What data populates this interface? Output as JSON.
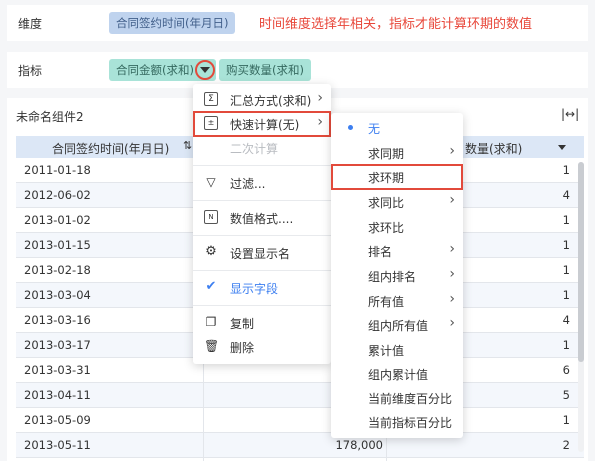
{
  "dimension_bar": {
    "label": "维度",
    "field": "合同签约时间(年月日)",
    "note": "时间维度选择年相关，指标才能计算环期的数值"
  },
  "metric_bar": {
    "label": "指标",
    "field1": "合同金额(求和)",
    "field2": "购买数量(求和)"
  },
  "component": {
    "title": "未命名组件2",
    "col1": "合同签约时间(年月日)",
    "col3": "数量(求和)"
  },
  "rows": [
    {
      "date": "2011-01-18",
      "mid": "",
      "right": "1"
    },
    {
      "date": "2012-06-02",
      "mid": "",
      "right": "4"
    },
    {
      "date": "2013-01-02",
      "mid": "",
      "right": "1"
    },
    {
      "date": "2013-01-15",
      "mid": "",
      "right": "1"
    },
    {
      "date": "2013-02-18",
      "mid": "",
      "right": "1"
    },
    {
      "date": "2013-03-04",
      "mid": "",
      "right": "1"
    },
    {
      "date": "2013-03-16",
      "mid": "",
      "right": "4"
    },
    {
      "date": "2013-03-17",
      "mid": "",
      "right": "1"
    },
    {
      "date": "2013-03-31",
      "mid": "",
      "right": "6"
    },
    {
      "date": "2013-04-11",
      "mid": "",
      "right": "5"
    },
    {
      "date": "2013-05-09",
      "mid": "",
      "right": "1"
    },
    {
      "date": "2013-05-11",
      "mid": "178,000",
      "right": "2"
    }
  ],
  "context_menu": {
    "items": [
      {
        "label": "汇总方式(求和)",
        "icon": "sum-icon"
      },
      {
        "label": "快速计算(无)",
        "icon": "calc-icon"
      },
      {
        "label": "二次计算",
        "icon": ""
      },
      {
        "label": "过滤...",
        "icon": "filter-icon"
      },
      {
        "label": "数值格式....",
        "icon": "number-format-icon"
      },
      {
        "label": "设置显示名",
        "icon": "gear-icon"
      },
      {
        "label": "显示字段",
        "icon": "check-icon"
      },
      {
        "label": "复制",
        "icon": "copy-icon"
      },
      {
        "label": "删除",
        "icon": "trash-icon"
      }
    ]
  },
  "submenu": {
    "items": [
      {
        "label": "无"
      },
      {
        "label": "求同期"
      },
      {
        "label": "求环期"
      },
      {
        "label": "求同比"
      },
      {
        "label": "求环比"
      },
      {
        "label": "排名"
      },
      {
        "label": "组内排名"
      },
      {
        "label": "所有值"
      },
      {
        "label": "组内所有值"
      },
      {
        "label": "累计值"
      },
      {
        "label": "组内累计值"
      },
      {
        "label": "当前维度百分比"
      },
      {
        "label": "当前指标百分比"
      }
    ]
  },
  "colors": {
    "accent": "#3d7ff0",
    "highlight": "#e24a3b",
    "dim_pill": "#bfd3ee",
    "metric_pill": "#a9e3d8"
  }
}
